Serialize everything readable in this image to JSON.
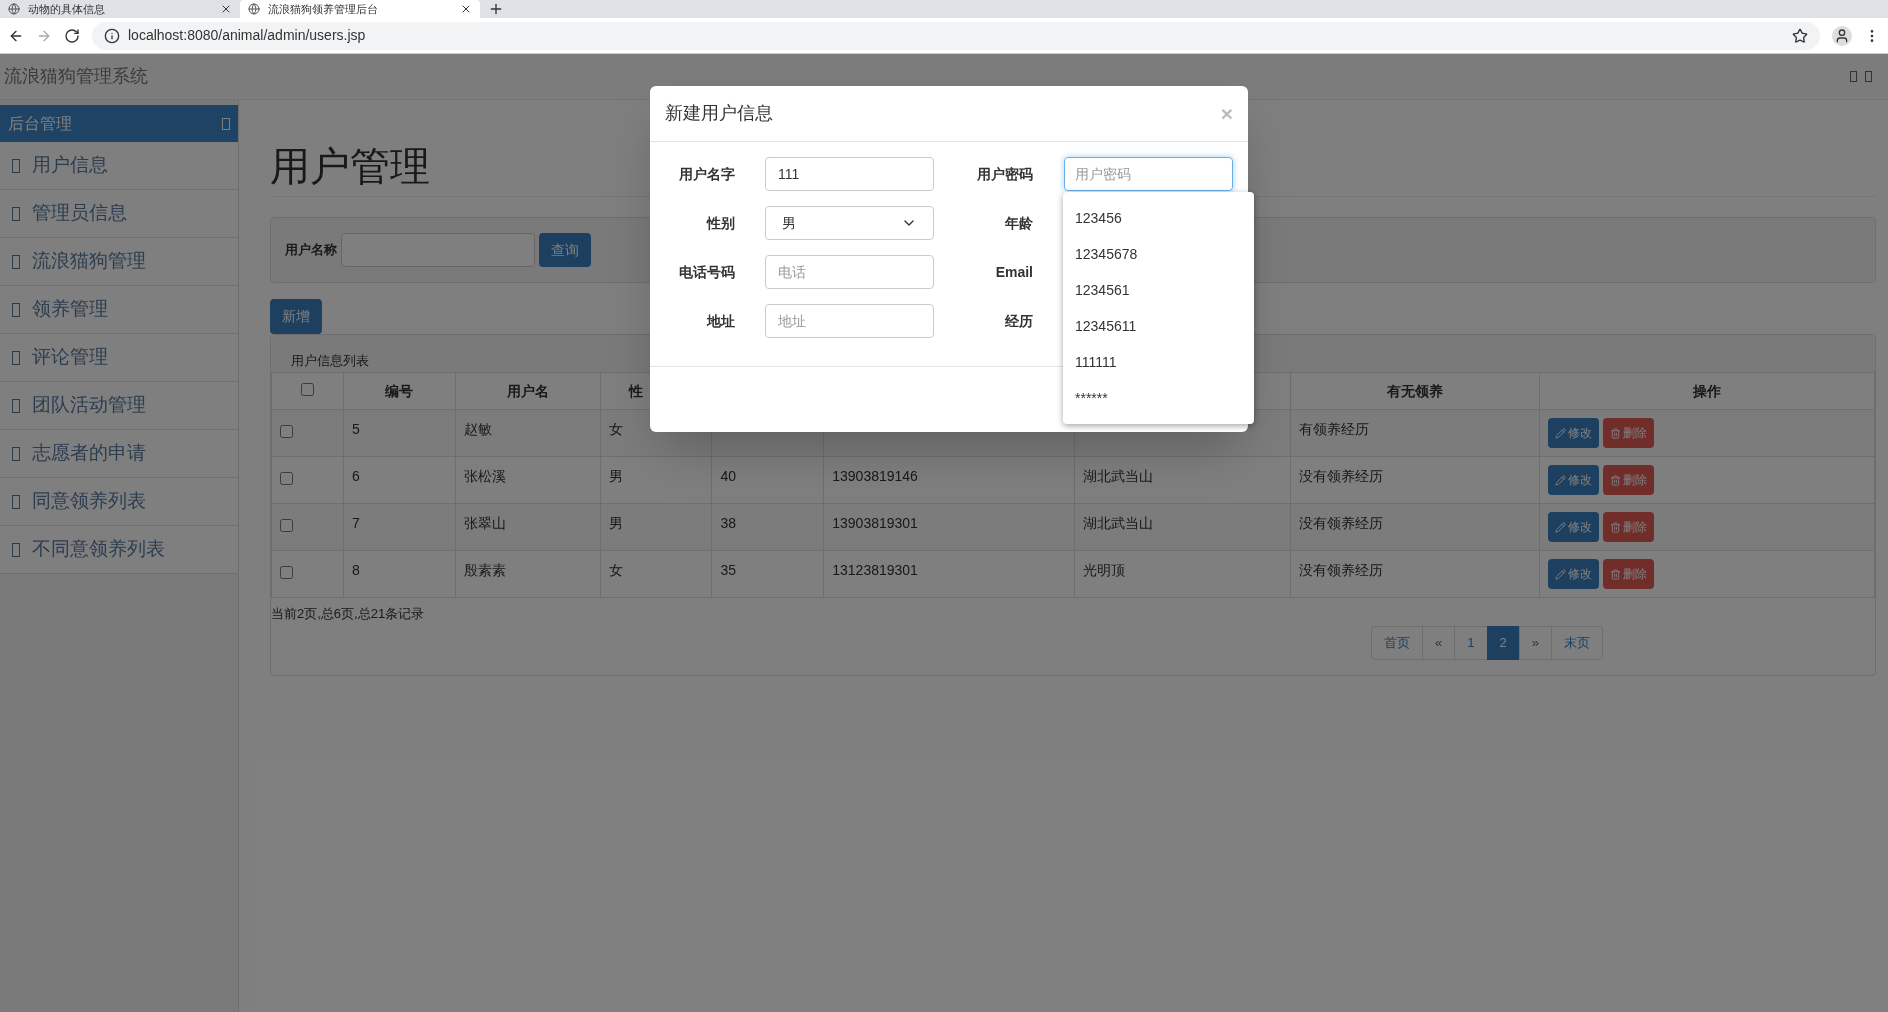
{
  "browser": {
    "tabs": [
      {
        "title": "动物的具体信息",
        "selected": false
      },
      {
        "title": "流浪猫狗领养管理后台",
        "selected": true
      }
    ],
    "url": "localhost:8080/animal/admin/users.jsp"
  },
  "navbar": {
    "brand": "流浪猫狗管理系统"
  },
  "sidebar": {
    "header": "后台管理",
    "items": [
      {
        "label": "用户信息"
      },
      {
        "label": "管理员信息"
      },
      {
        "label": "流浪猫狗管理"
      },
      {
        "label": "领养管理"
      },
      {
        "label": "评论管理"
      },
      {
        "label": "团队活动管理"
      },
      {
        "label": "志愿者的申请"
      },
      {
        "label": "同意领养列表"
      },
      {
        "label": "不同意领养列表"
      }
    ]
  },
  "page": {
    "title": "用户管理",
    "search": {
      "label": "用户名称",
      "button": "查询"
    },
    "add_button": "新增",
    "panel_title": "用户信息列表",
    "table": {
      "all_checked": false,
      "columns": [
        "编号",
        "用户名",
        "性",
        null,
        null,
        null,
        "有无领养",
        "操作"
      ],
      "rows": [
        {
          "checked": false,
          "cells": [
            "5",
            "赵敏",
            "女",
            null,
            null,
            null,
            "有领养经历"
          ],
          "actions": [
            "修改",
            "删除"
          ]
        },
        {
          "checked": false,
          "cells": [
            "6",
            "张松溪",
            "男",
            "40",
            "13903819146",
            "湖北武当山",
            "没有领养经历"
          ],
          "actions": [
            "修改",
            "删除"
          ]
        },
        {
          "checked": false,
          "cells": [
            "7",
            "张翠山",
            "男",
            "38",
            "13903819301",
            "湖北武当山",
            "没有领养经历"
          ],
          "actions": [
            "修改",
            "删除"
          ]
        },
        {
          "checked": false,
          "cells": [
            "8",
            "殷素素",
            "女",
            "35",
            "13123819301",
            "光明顶",
            "没有领养经历"
          ],
          "actions": [
            "修改",
            "删除"
          ]
        }
      ]
    },
    "summary": "当前2页,总6页,总21条记录",
    "pagination": [
      {
        "label": "首页",
        "selected": false
      },
      {
        "label": "«",
        "selected": false
      },
      {
        "label": "1",
        "selected": false
      },
      {
        "label": "2",
        "selected": true
      },
      {
        "label": "»",
        "selected": false
      },
      {
        "label": "末页",
        "selected": false
      }
    ]
  },
  "modal": {
    "title": "新建用户信息",
    "close": "×",
    "left_fields": [
      {
        "label": "用户名字",
        "kind": "input",
        "value": "111"
      },
      {
        "label": "性别",
        "kind": "select",
        "value": "男"
      },
      {
        "label": "电话号码",
        "kind": "input",
        "placeholder": "电话"
      },
      {
        "label": "地址",
        "kind": "input",
        "placeholder": "地址"
      }
    ],
    "right_fields": [
      {
        "label": "用户密码",
        "placeholder": "用户密码",
        "focused": true
      },
      {
        "label": "年龄"
      },
      {
        "label": "Email"
      },
      {
        "label": "经历"
      }
    ],
    "suggestions": [
      "123456",
      "12345678",
      "1234561",
      "12345611",
      "111111",
      "******"
    ]
  }
}
